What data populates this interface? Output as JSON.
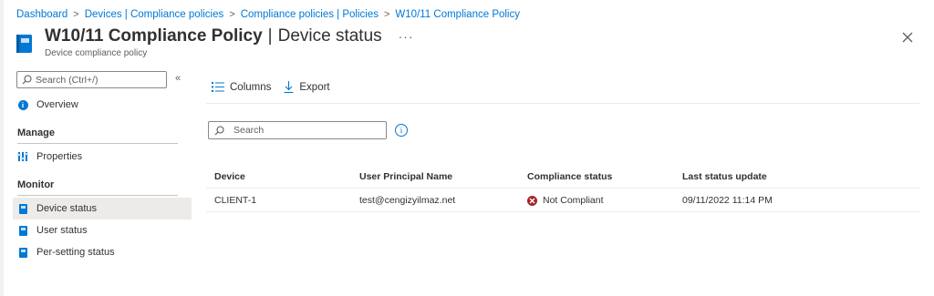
{
  "breadcrumb": [
    {
      "label": "Dashboard"
    },
    {
      "label": "Devices | Compliance policies"
    },
    {
      "label": "Compliance policies | Policies"
    },
    {
      "label": "W10/11 Compliance Policy"
    }
  ],
  "header": {
    "title": "W10/11 Compliance Policy",
    "separator": "|",
    "section": "Device status",
    "subtitle": "Device compliance policy",
    "more_label": "···"
  },
  "sidebar": {
    "search_placeholder": "Search (Ctrl+/)",
    "collapse_label": "«",
    "overview": "Overview",
    "sections": [
      {
        "title": "Manage",
        "items": [
          {
            "label": "Properties",
            "icon": "settings-sliders-icon"
          }
        ]
      },
      {
        "title": "Monitor",
        "items": [
          {
            "label": "Device status",
            "icon": "device-page-icon",
            "active": true
          },
          {
            "label": "User status",
            "icon": "user-page-icon"
          },
          {
            "label": "Per-setting status",
            "icon": "setting-page-icon"
          }
        ]
      }
    ]
  },
  "toolbar": {
    "columns_label": "Columns",
    "export_label": "Export"
  },
  "main": {
    "search_placeholder": "Search",
    "info_icon": "i",
    "table": {
      "columns": [
        "Device",
        "User Principal Name",
        "Compliance status",
        "Last status update"
      ],
      "rows": [
        {
          "device": "CLIENT-1",
          "upn": "test@cengizyilmaz.net",
          "status": "Not Compliant",
          "status_icon": "error-x-icon",
          "last_update": "09/11/2022 11:14 PM"
        }
      ]
    }
  },
  "colors": {
    "accent": "#0078d4",
    "error": "#a4262c",
    "active_bg": "#edebe9"
  }
}
